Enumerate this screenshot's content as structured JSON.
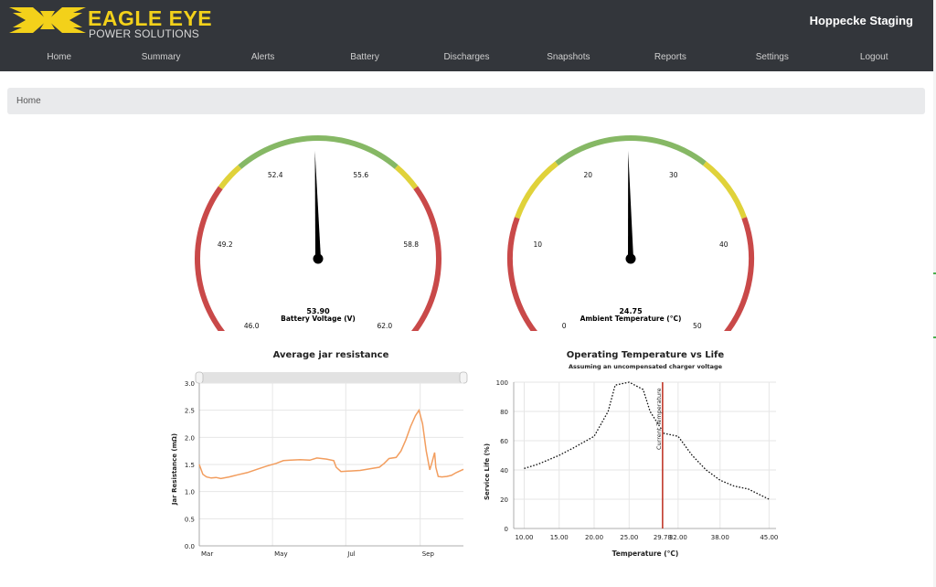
{
  "brand": {
    "name": "EAGLE EYE",
    "tagline": "POWER SOLUTIONS"
  },
  "site_name": "Hoppecke Staging",
  "nav": [
    {
      "label": "Home"
    },
    {
      "label": "Summary"
    },
    {
      "label": "Alerts"
    },
    {
      "label": "Battery"
    },
    {
      "label": "Discharges"
    },
    {
      "label": "Snapshots"
    },
    {
      "label": "Reports"
    },
    {
      "label": "Settings"
    },
    {
      "label": "Logout"
    }
  ],
  "breadcrumb": "Home",
  "colors": {
    "header_bg": "#33363b",
    "logo_yellow": "#f3d11a",
    "gauge_red": "#c94949",
    "gauge_yellow": "#e0d23a",
    "gauge_green": "#86b865",
    "line_orange": "#f29d5e",
    "marker_red": "#c0392b"
  },
  "gauges": [
    {
      "name": "battery-voltage-gauge",
      "min": 46.0,
      "max": 62.0,
      "value": 53.9,
      "value_text": "53.90",
      "label": "Battery Voltage (V)",
      "ticks": [
        "46.0",
        "49.2",
        "52.4",
        "55.6",
        "58.8",
        "62.0"
      ],
      "bands": [
        {
          "from": 46.0,
          "to": 50.8,
          "color": "red"
        },
        {
          "from": 50.8,
          "to": 51.6,
          "color": "yellow"
        },
        {
          "from": 51.6,
          "to": 56.4,
          "color": "green"
        },
        {
          "from": 56.4,
          "to": 57.2,
          "color": "yellow"
        },
        {
          "from": 57.2,
          "to": 62.0,
          "color": "red"
        }
      ]
    },
    {
      "name": "ambient-temperature-gauge",
      "min": 0,
      "max": 50,
      "value": 24.75,
      "value_text": "24.75",
      "label": "Ambient Temperature (°C)",
      "ticks": [
        "0",
        "10",
        "20",
        "30",
        "40",
        "50"
      ],
      "bands": [
        {
          "from": 0,
          "to": 12,
          "color": "red"
        },
        {
          "from": 12,
          "to": 18,
          "color": "yellow"
        },
        {
          "from": 18,
          "to": 32,
          "color": "green"
        },
        {
          "from": 32,
          "to": 38,
          "color": "yellow"
        },
        {
          "from": 38,
          "to": 50,
          "color": "red"
        }
      ]
    }
  ],
  "chart_data": [
    {
      "type": "line",
      "title": "Average jar resistance",
      "xlabel": "",
      "ylabel": "Jar Resistance (mΩ)",
      "ylim": [
        0,
        3.0
      ],
      "yticks": [
        "0.0",
        "0.5",
        "1.0",
        "1.5",
        "2.0",
        "2.5",
        "3.0"
      ],
      "xticks": [
        {
          "label": "Mar",
          "t": 0
        },
        {
          "label": "May",
          "t": 61
        },
        {
          "label": "Jul",
          "t": 122
        },
        {
          "label": "Sep",
          "t": 184
        }
      ],
      "xlim_days": [
        0,
        220
      ],
      "grid": true,
      "series": [
        {
          "x": [
            0,
            3,
            6,
            10,
            14,
            18,
            25,
            32,
            40,
            48,
            56,
            64,
            70,
            76,
            84,
            92,
            98,
            106,
            112,
            114,
            118,
            126,
            134,
            142,
            150,
            154,
            158,
            164,
            168,
            172,
            176,
            180,
            183,
            186,
            189,
            192,
            194,
            196,
            197,
            199,
            202,
            206,
            210,
            214,
            220
          ],
          "y": [
            1.5,
            1.32,
            1.27,
            1.25,
            1.26,
            1.24,
            1.27,
            1.31,
            1.35,
            1.41,
            1.47,
            1.52,
            1.57,
            1.58,
            1.59,
            1.58,
            1.62,
            1.6,
            1.57,
            1.45,
            1.37,
            1.38,
            1.39,
            1.42,
            1.45,
            1.52,
            1.61,
            1.63,
            1.75,
            1.95,
            2.2,
            2.4,
            2.5,
            2.25,
            1.75,
            1.4,
            1.55,
            1.72,
            1.45,
            1.28,
            1.27,
            1.28,
            1.3,
            1.35,
            1.41
          ]
        }
      ]
    },
    {
      "type": "line",
      "title": "Operating Temperature vs Life",
      "subtitle": "Assuming an uncompensated charger voltage",
      "xlabel": "Temperature (°C)",
      "ylabel": "Service Life (%)",
      "xlim": [
        8.5,
        46
      ],
      "ylim": [
        0,
        100
      ],
      "xticks": [
        "10.00",
        "15.00",
        "20.00",
        "25.00",
        "29.78",
        "32.00",
        "38.00",
        "45.00"
      ],
      "xtick_values": [
        10,
        15,
        20,
        25,
        29.78,
        32,
        38,
        45
      ],
      "yticks": [
        "0",
        "20",
        "40",
        "60",
        "80",
        "100"
      ],
      "grid": true,
      "series": [
        {
          "x": [
            10,
            12,
            15,
            17,
            20,
            22,
            23,
            25,
            27,
            28,
            30,
            32,
            34,
            36,
            38,
            40,
            42,
            45
          ],
          "y": [
            41,
            44,
            50,
            55,
            63,
            80,
            98,
            100,
            95,
            80,
            65,
            63,
            50,
            40,
            33,
            29,
            27,
            20
          ]
        }
      ],
      "marker": {
        "x": 29.78,
        "label": "Current Temperature"
      }
    }
  ]
}
